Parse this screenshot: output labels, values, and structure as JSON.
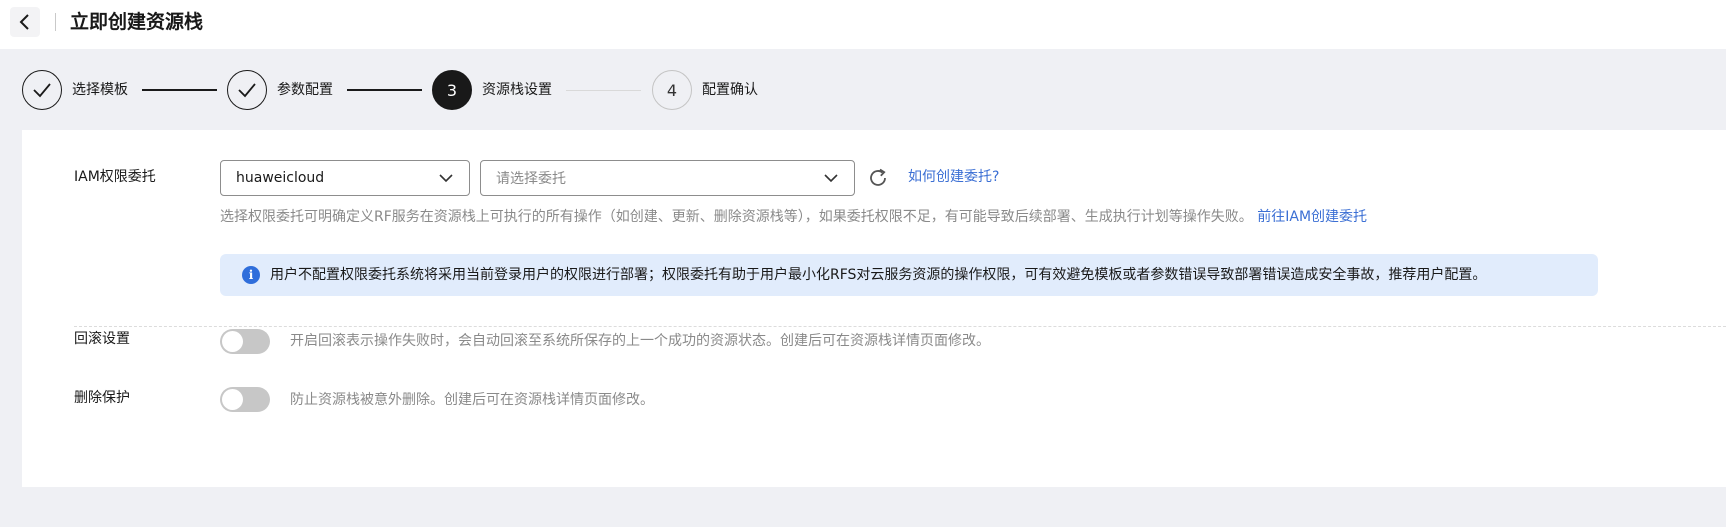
{
  "header": {
    "title": "立即创建资源栈",
    "back_icon": "chevron-left-icon"
  },
  "steps": [
    {
      "number": "1",
      "label": "选择模板",
      "state": "done"
    },
    {
      "number": "2",
      "label": "参数配置",
      "state": "done"
    },
    {
      "number": "3",
      "label": "资源栈设置",
      "state": "current"
    },
    {
      "number": "4",
      "label": "配置确认",
      "state": "pending"
    }
  ],
  "iam": {
    "label": "IAM权限委托",
    "provider_value": "huaweicloud",
    "agency_placeholder": "请选择委托",
    "help_link": "如何创建委托?",
    "hint_text": "选择权限委托可明确定义RF服务在资源栈上可执行的所有操作（如创建、更新、删除资源栈等），如果委托权限不足，有可能导致后续部署、生成执行计划等操作失败。",
    "hint_link": "前往IAM创建委托",
    "info_text": "用户不配置权限委托系统将采用当前登录用户的权限进行部署；权限委托有助于用户最小化RFS对云服务资源的操作权限，可有效避免模板或者参数错误导致部署错误造成安全事故，推荐用户配置。"
  },
  "rollback": {
    "label": "回滚设置",
    "enabled": false,
    "description": "开启回滚表示操作失败时，会自动回滚至系统所保存的上一个成功的资源状态。创建后可在资源栈详情页面修改。"
  },
  "deletion_protection": {
    "label": "删除保护",
    "enabled": false,
    "description": "防止资源栈被意外删除。创建后可在资源栈详情页面修改。"
  },
  "colors": {
    "accent": "#3b6fd4",
    "info_bg": "#e1ecfc",
    "step_active": "#191919"
  }
}
